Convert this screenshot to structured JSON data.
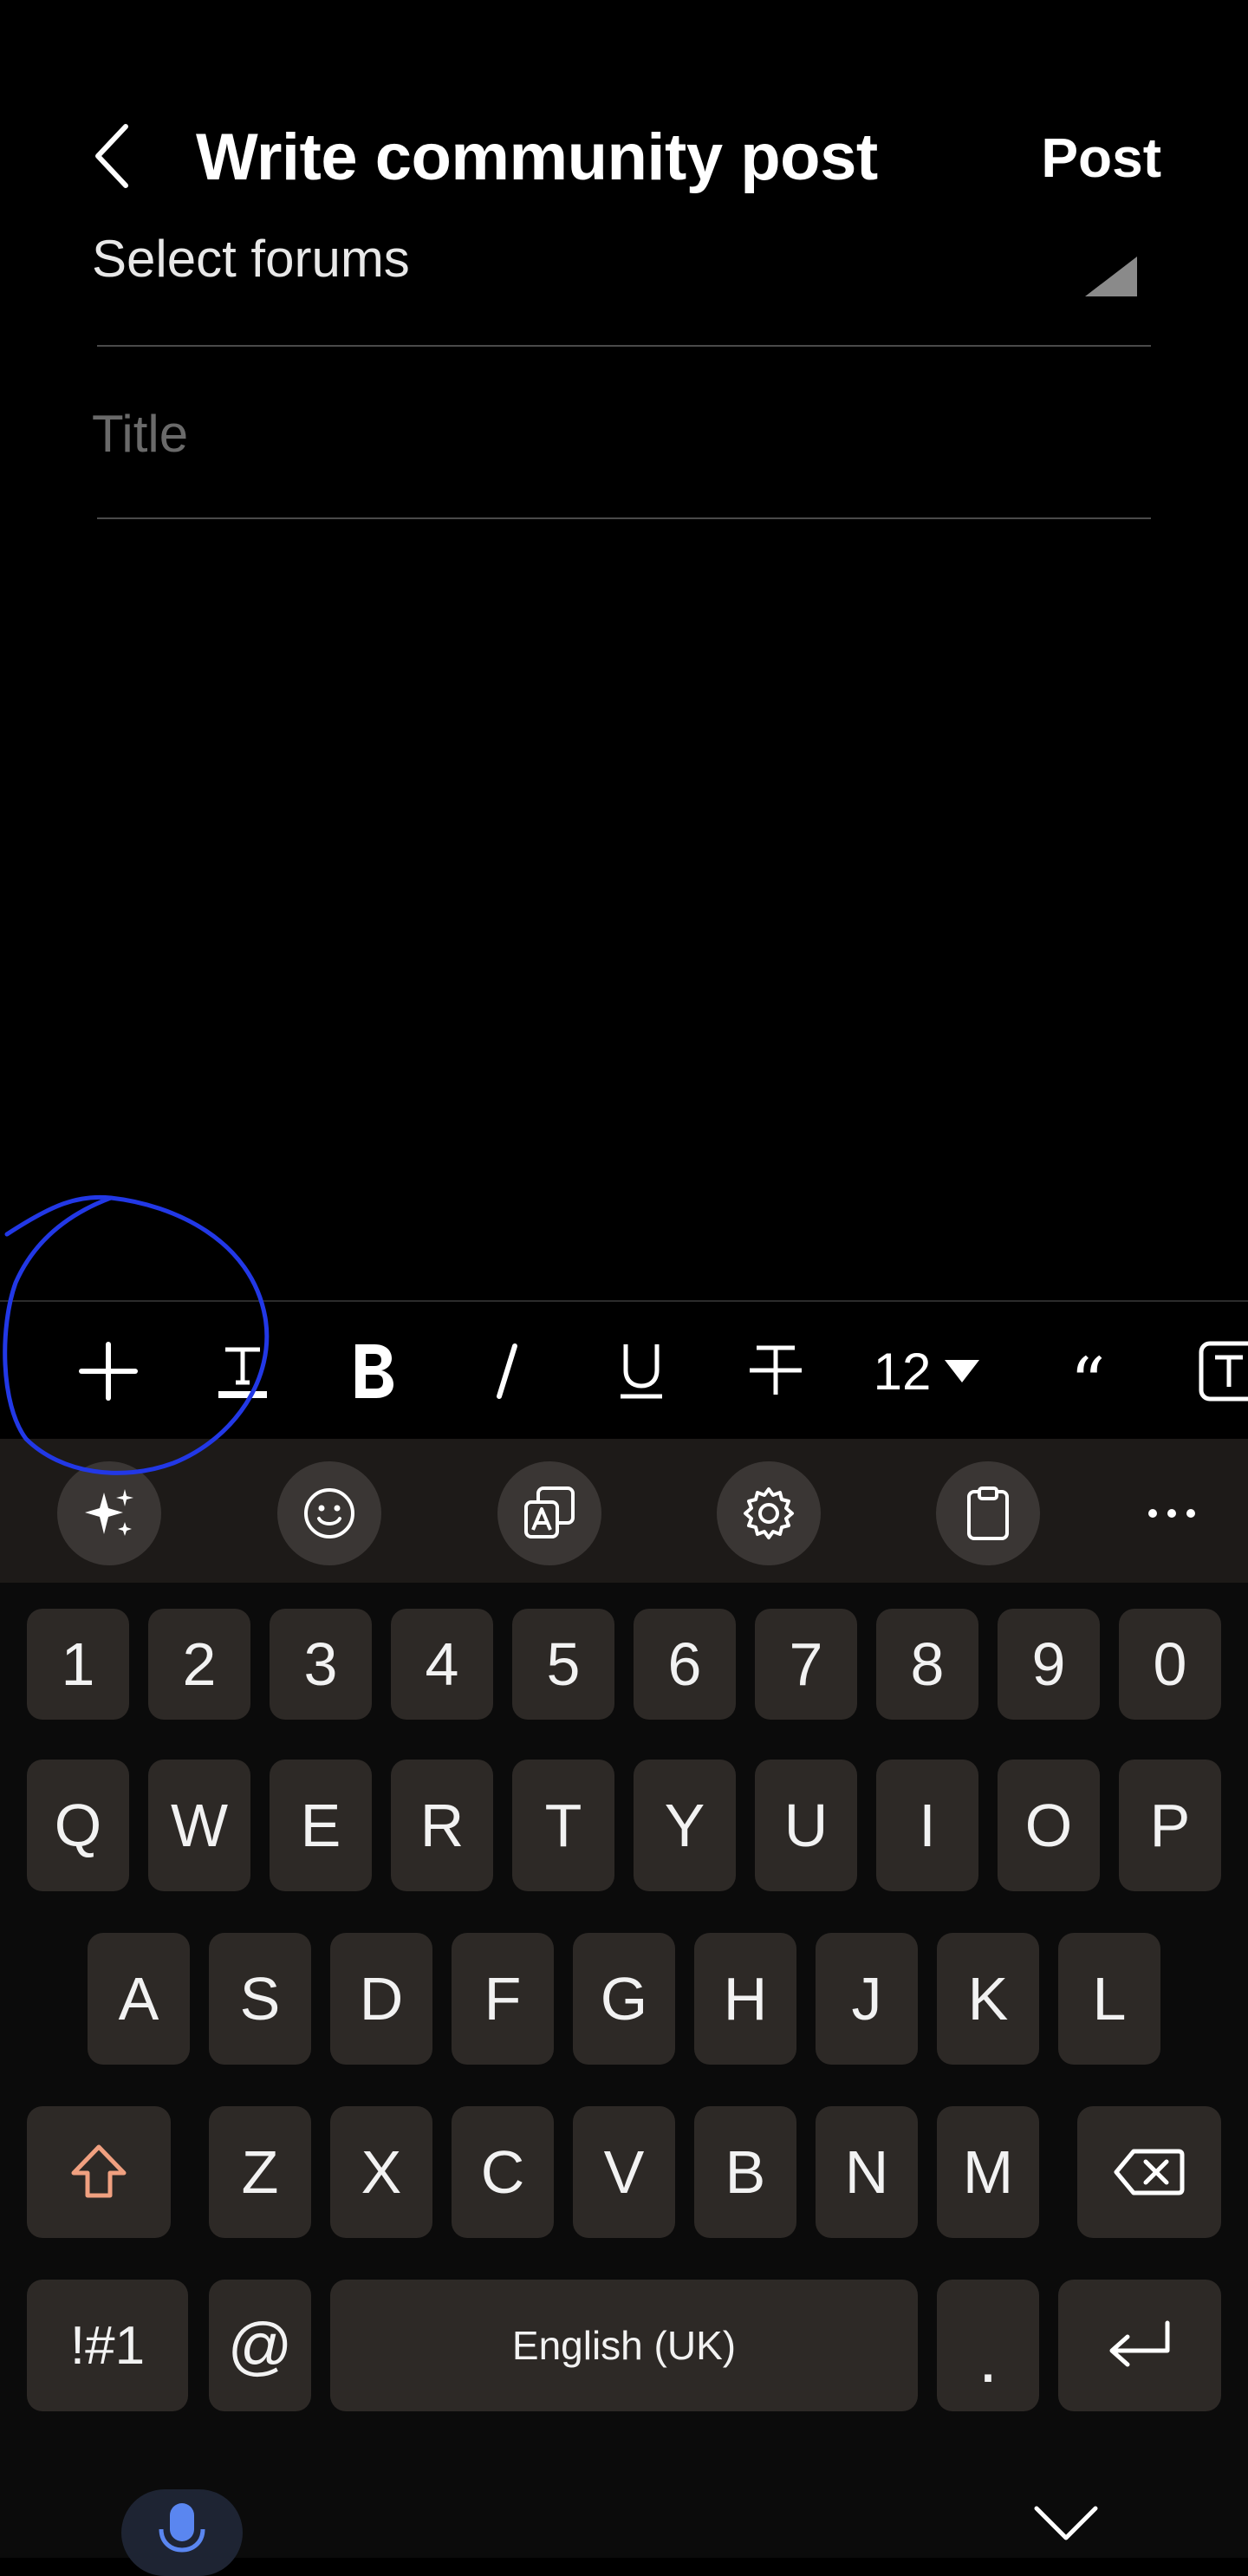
{
  "header": {
    "title": "Write community post",
    "post_label": "Post"
  },
  "form": {
    "forum_label": "Select forums",
    "title_placeholder": "Title"
  },
  "format_toolbar": {
    "font_size": "12",
    "quote_glyph": "“"
  },
  "keyboard": {
    "number_row": [
      "1",
      "2",
      "3",
      "4",
      "5",
      "6",
      "7",
      "8",
      "9",
      "0"
    ],
    "row1": [
      "Q",
      "W",
      "E",
      "R",
      "T",
      "Y",
      "U",
      "I",
      "O",
      "P"
    ],
    "row2": [
      "A",
      "S",
      "D",
      "F",
      "G",
      "H",
      "J",
      "K",
      "L"
    ],
    "row3": [
      "Z",
      "X",
      "C",
      "V",
      "B",
      "N",
      "M"
    ],
    "symbols_label": "!#1",
    "at_label": "@",
    "space_label": "English (UK)",
    "period_label": ".",
    "more_label": "···"
  },
  "colors": {
    "background": "#000000",
    "key": "#2d2926",
    "keyboard_toolbar": "#1d1a18",
    "shift_accent": "#f0a080",
    "mic_accent": "#5a86f0",
    "annotation": "#2238e6"
  }
}
